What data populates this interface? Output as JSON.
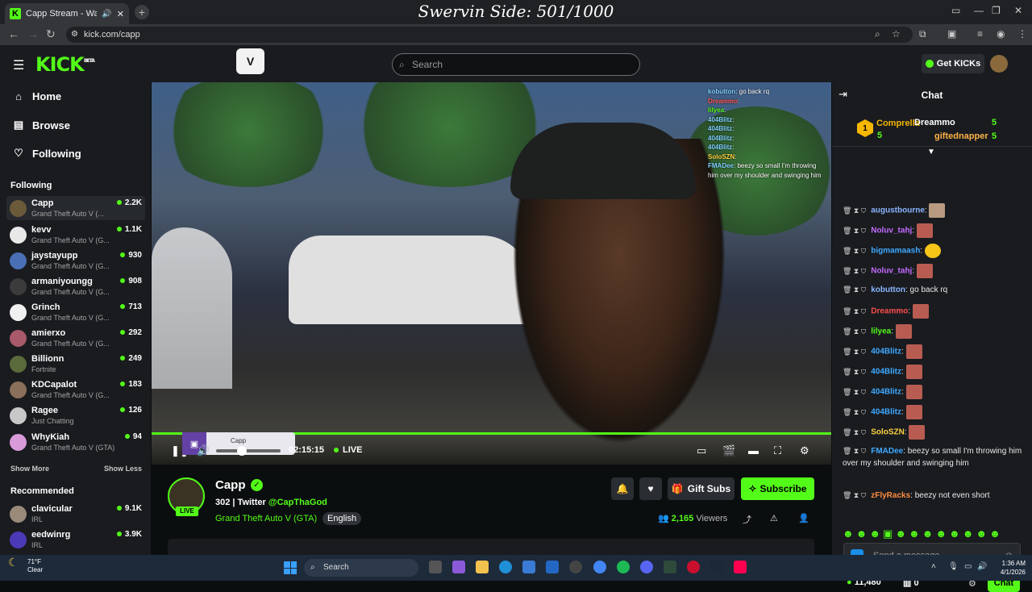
{
  "browser": {
    "tab_title": "Capp Stream - Watch Live o",
    "tab_favicon": "K",
    "new_tab": "+",
    "url": "kick.com/capp",
    "overlay_text": "Swervin Side: 501/1000"
  },
  "topnav": {
    "logo": "KICK",
    "logo_sup": "BETA",
    "search_placeholder": "Search",
    "get_kicks": "Get KICKs",
    "accent": "#53fc18"
  },
  "sidebar": {
    "main": [
      {
        "label": "Home",
        "icon": "home-icon"
      },
      {
        "label": "Browse",
        "icon": "browse-icon"
      },
      {
        "label": "Following",
        "icon": "heart-icon"
      }
    ],
    "following_heading": "Following",
    "following": [
      {
        "name": "Capp",
        "game": "Grand Theft Auto V (...",
        "viewers": "2.2K"
      },
      {
        "name": "kevv",
        "game": "Grand Theft Auto V (G...",
        "viewers": "1.1K"
      },
      {
        "name": "jaystayupp",
        "game": "Grand Theft Auto V (G...",
        "viewers": "930"
      },
      {
        "name": "armaniyoungg",
        "game": "Grand Theft Auto V (G...",
        "viewers": "908"
      },
      {
        "name": "Grinch",
        "game": "Grand Theft Auto V (G...",
        "viewers": "713"
      },
      {
        "name": "amierxo",
        "game": "Grand Theft Auto V (G...",
        "viewers": "292"
      },
      {
        "name": "Billionn",
        "game": "Fortnite",
        "viewers": "249"
      },
      {
        "name": "KDCapalot",
        "game": "Grand Theft Auto V (G...",
        "viewers": "183"
      },
      {
        "name": "Ragee",
        "game": "Just Chatting",
        "viewers": "126"
      },
      {
        "name": "WhyKiah",
        "game": "Grand Theft Auto V (GTA)",
        "viewers": "94"
      }
    ],
    "show_more": "Show More",
    "show_less": "Show Less",
    "recommended_heading": "Recommended",
    "recommended": [
      {
        "name": "clavicular",
        "game": "IRL",
        "viewers": "9.1K"
      },
      {
        "name": "eedwinrg",
        "game": "IRL",
        "viewers": "3.9K"
      }
    ]
  },
  "video": {
    "time": "02:15:15",
    "live": "LIVE",
    "mini_name": "Capp",
    "overlay_chat": [
      {
        "user": "kobutton",
        "text": ": go back rq"
      },
      {
        "user": "Dreammo",
        "text": ":"
      },
      {
        "user": "lilyea",
        "text": ":"
      },
      {
        "user": "404Blitz",
        "text": ":"
      },
      {
        "user": "404Blitz",
        "text": ":"
      },
      {
        "user": "404Blitz",
        "text": ":"
      },
      {
        "user": "404Blitz",
        "text": ":"
      },
      {
        "user": "SoloSZN",
        "text": ":"
      },
      {
        "user": "FMADee",
        "text": ": beezy so small I'm throwing him over my shoulder and swinging him"
      }
    ]
  },
  "channel": {
    "name": "Capp",
    "live_badge": "LIVE",
    "followers_line": "302 | Twitter ",
    "twitter": "@CapThaGod",
    "game": "Grand Theft Auto V (GTA)",
    "language": "English",
    "gift_subs": "Gift Subs",
    "subscribe": "Subscribe",
    "viewers_count": "2,165",
    "viewers_label": " Viewers"
  },
  "chat": {
    "title": "Chat",
    "leaderboard": [
      {
        "rank": "1",
        "name": "Comprella",
        "count": "5"
      },
      {
        "name": "Dreammo",
        "count": "5"
      },
      {
        "name": "giftednapper",
        "count": "5"
      }
    ],
    "messages": [
      {
        "user": "augustbourne",
        "color": "#8ab4ff",
        "text": ":",
        "emote": true
      },
      {
        "user": "Noluv_tahj",
        "color": "#c36bff",
        "text": ":",
        "emote": true
      },
      {
        "user": "bigmamaash",
        "color": "#3fa9ff",
        "text": ":",
        "emote": true
      },
      {
        "user": "Noluv_tahj",
        "color": "#c36bff",
        "text": ":",
        "emote": true
      },
      {
        "user": "kobutton",
        "color": "#8ab4ff",
        "text": ": go back rq",
        "emote": false
      },
      {
        "user": "Dreammo",
        "color": "#ff4d4d",
        "text": ":",
        "emote": true
      },
      {
        "user": "lilyea",
        "color": "#53fc18",
        "text": ":",
        "emote": true
      },
      {
        "user": "404Blitz",
        "color": "#3fa9ff",
        "text": ":",
        "emote": true
      },
      {
        "user": "404Blitz",
        "color": "#3fa9ff",
        "text": ":",
        "emote": true
      },
      {
        "user": "404Blitz",
        "color": "#3fa9ff",
        "text": ":",
        "emote": true
      },
      {
        "user": "404Blitz",
        "color": "#3fa9ff",
        "text": ":",
        "emote": true
      },
      {
        "user": "SoloSZN",
        "color": "#ffd23f",
        "text": ":",
        "emote": true
      },
      {
        "user": "FMADee",
        "color": "#3fa9ff",
        "text": ": beezy so small I'm throwing him over my shoulder and swinging him",
        "emote": false
      },
      {
        "user": "zFlyRacks",
        "color": "#8ab4ff",
        "text": ": beezy not even short",
        "emote": false
      }
    ],
    "input_placeholder": "Send a message",
    "kicks_balance": "11,480",
    "chest_count": "0",
    "send": "Chat"
  },
  "taskbar": {
    "temp": "71°F",
    "weather": "Clear",
    "search": "Search",
    "time": "1:36 AM",
    "date": "4/1/2026"
  }
}
